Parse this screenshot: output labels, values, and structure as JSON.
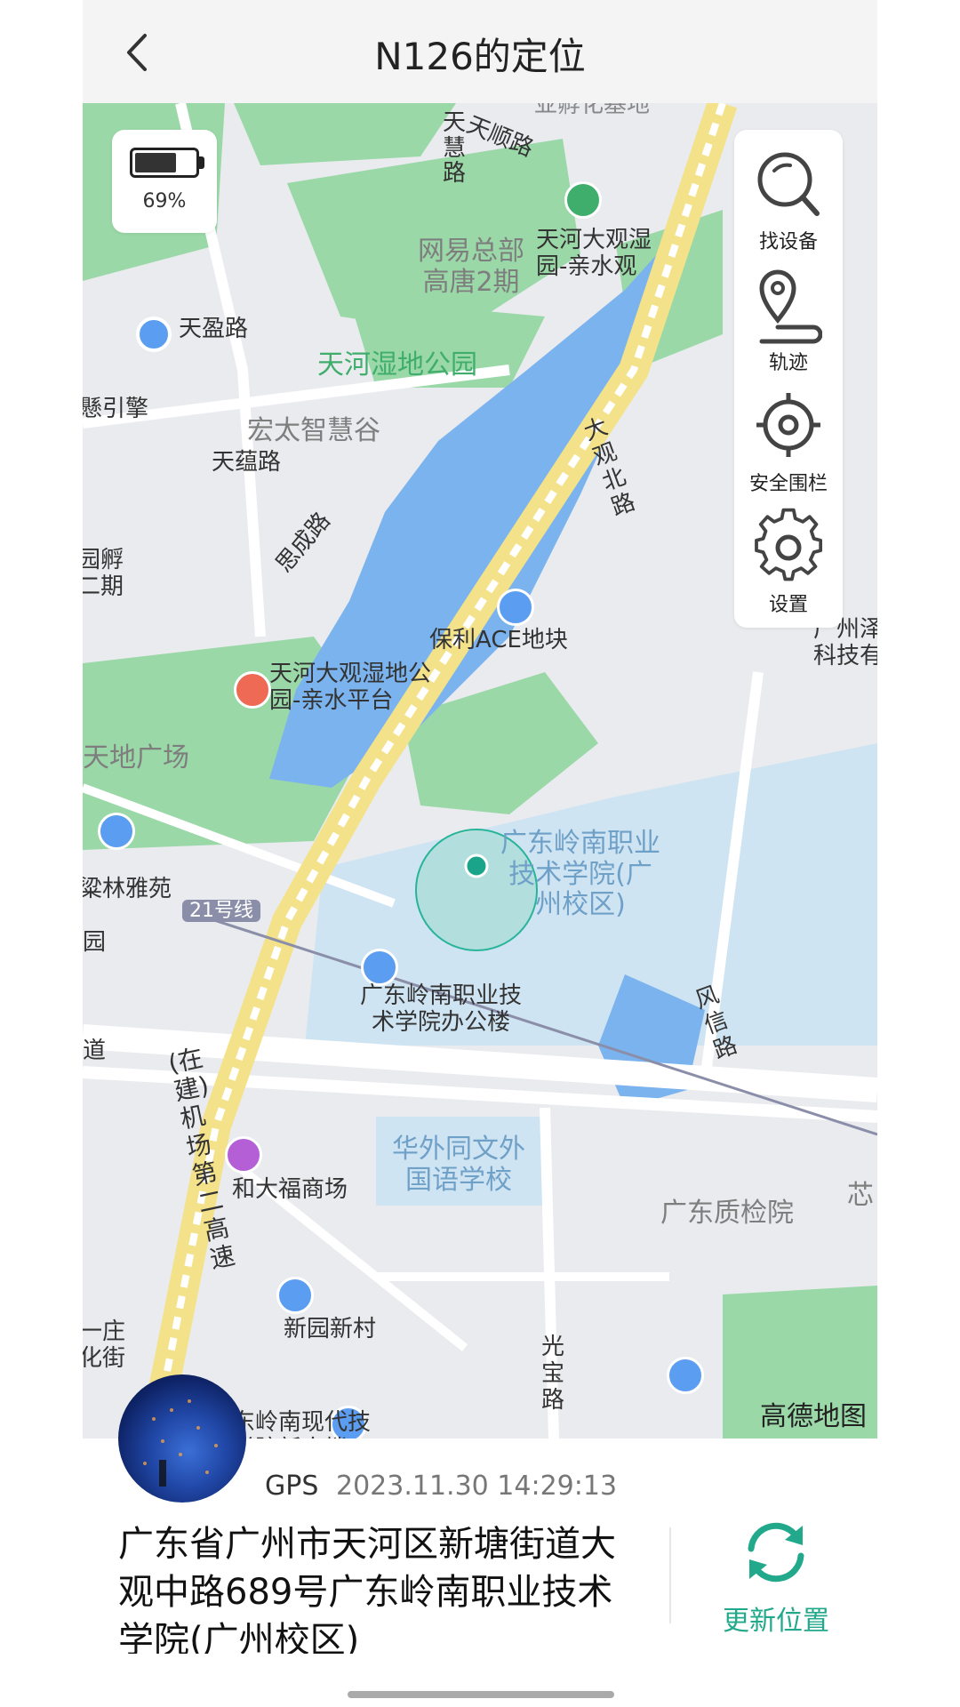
{
  "header": {
    "title": "N126的定位"
  },
  "battery": {
    "percent_text": "69%",
    "level": 0.69
  },
  "tools": [
    {
      "label": "找设备",
      "icon": "search-device-icon"
    },
    {
      "label": "轨迹",
      "icon": "track-icon"
    },
    {
      "label": "安全围栏",
      "icon": "geofence-icon"
    },
    {
      "label": "设置",
      "icon": "gear-icon"
    }
  ],
  "map": {
    "provider_logo": "高德地图",
    "labels": {
      "tianshun_road": "天顺路",
      "tian_hui_road": "天\n慧\n路",
      "wangyi": "网易总部\n高唐2期",
      "tianying_road": "天盈路",
      "wetland_park": "天河湿地公园",
      "hongtai": "宏太智慧谷",
      "yinqing": "懸引擎",
      "tianyun_road": "天蕴路",
      "sicheng_road": "思成路",
      "daguan_north_road": "大\n观\n北\n路",
      "incubator": "园孵\n二期",
      "poly_ace": "保利ACE地块",
      "tianhe_daguan": "天河大观湿\n园-亲水观",
      "qinshui_platform": "天河大观湿地公\n园-亲水平台",
      "guangzhou_tech": "广州泽\n科技有",
      "tiandi_plaza": "天地广场",
      "linya_yuan": "粱林雅苑",
      "line21": "21号线",
      "yuan": "园",
      "lingnan_college": "广东岭南职业\n技术学院(广\n州校区)",
      "office_building": "广东岭南职业技\n术学院办公楼",
      "dao": "道",
      "fengxin_road": "风\n信\n路",
      "airport_expressway": "(在\n建)\n机\n场\n第\n二\n高\n速",
      "dafu_mall": "和大福商场",
      "huawai_school": "华外同文外\n国语学校",
      "quality_inspection": "广东质检院",
      "xinyuan_village": "新园新村",
      "guangbao_road": "光\n宝\n路",
      "lingnan_modern": "东岭南现代技\n学院新南楼",
      "zhuang": "一庄\n化街",
      "xin": "芯",
      "dasheng": "亚孵化基地"
    }
  },
  "location": {
    "source": "GPS",
    "timestamp": "2023.11.30 14:29:13",
    "address": "广东省广州市天河区新塘街道大观中路689号广东岭南职业技术学院(广州校区)"
  },
  "actions": {
    "refresh_label": "更新位置"
  }
}
